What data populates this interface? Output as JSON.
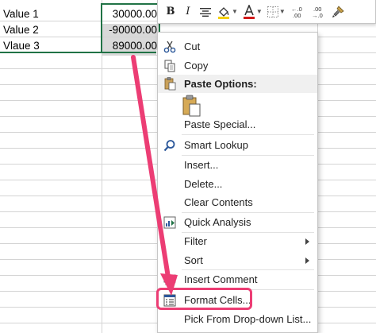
{
  "sheet": {
    "rows": [
      {
        "label": "Value 1",
        "value": "30000.00"
      },
      {
        "label": "Value 2",
        "value": "-90000.00"
      },
      {
        "label": "Vlaue 3",
        "value": "89000.00"
      }
    ]
  },
  "mini_toolbar": {
    "bold": "B",
    "italic": "I",
    "font_color_letter": "A",
    "decrease_decimal": "←.0\n.00",
    "increase_decimal": ".00\n→.0"
  },
  "context_menu": {
    "cut": "Cut",
    "copy": "Copy",
    "paste_options": "Paste Options:",
    "paste_special": "Paste Special...",
    "smart_lookup": "Smart Lookup",
    "insert": "Insert...",
    "delete": "Delete...",
    "clear_contents": "Clear Contents",
    "quick_analysis": "Quick Analysis",
    "filter": "Filter",
    "sort": "Sort",
    "insert_comment": "Insert Comment",
    "format_cells": "Format Cells...",
    "pick_from_list": "Pick From Drop-down List..."
  },
  "colors": {
    "selection_border": "#217346",
    "annotation": "#ec3d74",
    "highlight_fill": "#f5d000",
    "font_color_bar": "#d11b1b"
  }
}
